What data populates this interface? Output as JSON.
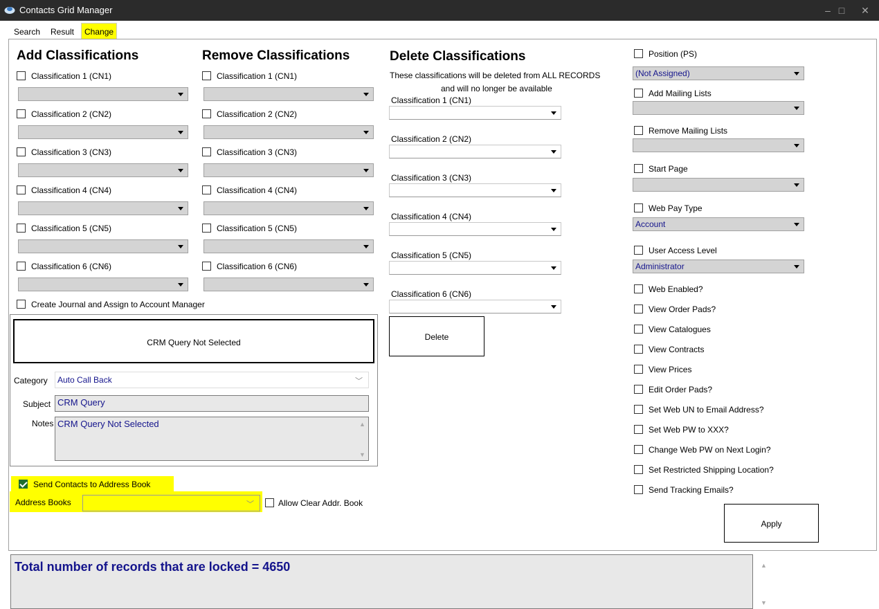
{
  "window": {
    "title": "Contacts Grid Manager",
    "controls": [
      "–",
      "□",
      "✕"
    ]
  },
  "tabs": [
    {
      "label": "Search"
    },
    {
      "label": "Result"
    },
    {
      "label": "Change"
    }
  ],
  "add": {
    "heading": "Add Classifications",
    "items": [
      "Classification 1 (CN1)",
      "Classification 2 (CN2)",
      "Classification 3 (CN3)",
      "Classification 4 (CN4)",
      "Classification 5 (CN5)",
      "Classification 6 (CN6)"
    ]
  },
  "remove": {
    "heading": "Remove Classifications",
    "items": [
      "Classification 1 (CN1)",
      "Classification 2 (CN2)",
      "Classification 3 (CN3)",
      "Classification 4 (CN4)",
      "Classification 5 (CN5)",
      "Classification 6 (CN6)"
    ]
  },
  "delete": {
    "heading": "Delete Classifications",
    "note_line1": "These classifications will be deleted from ALL RECORDS",
    "note_line2": "and will no longer be available",
    "items": [
      "Classification 1 (CN1)",
      "Classification 2 (CN2)",
      "Classification 3 (CN3)",
      "Classification 4 (CN4)",
      "Classification 5 (CN5)",
      "Classification 6 (CN6)"
    ],
    "button": "Delete"
  },
  "journal": {
    "checkbox": "Create Journal and Assign to Account Manager",
    "query_button": "CRM Query Not Selected",
    "category_label": "Category",
    "category_value": "Auto Call Back",
    "subject_label": "Subject",
    "subject_value": "CRM Query",
    "notes_label": "Notes",
    "notes_value": "CRM Query Not Selected"
  },
  "address": {
    "send_label": "Send Contacts to Address Book",
    "books_label": "Address Books",
    "books_value": "",
    "allow_clear_label": "Allow Clear Addr. Book"
  },
  "right": {
    "position_label": "Position (PS)",
    "position_value": "(Not Assigned)",
    "add_mailing_label": "Add Mailing Lists",
    "remove_mailing_label": "Remove Mailing Lists",
    "start_page_label": "Start Page",
    "web_pay_label": "Web Pay Type",
    "web_pay_value": "Account",
    "access_label": "User Access Level",
    "access_value": "Administrator",
    "options": [
      "Web Enabled?",
      "View Order Pads?",
      "View Catalogues",
      "View Contracts",
      "View Prices",
      "Edit Order Pads?",
      "Set Web UN to Email Address?",
      "Set Web PW to XXX?",
      "Change Web PW on Next Login?",
      "Set Restricted Shipping Location?",
      "Send Tracking Emails?"
    ],
    "apply_button": "Apply"
  },
  "status": {
    "text": "Total number of records that are locked = 4650"
  },
  "colors": {
    "highlight": "#ffff00",
    "titlebar": "#2b2b2b",
    "value_text": "#14148c",
    "checked": "#1f6e2e"
  }
}
